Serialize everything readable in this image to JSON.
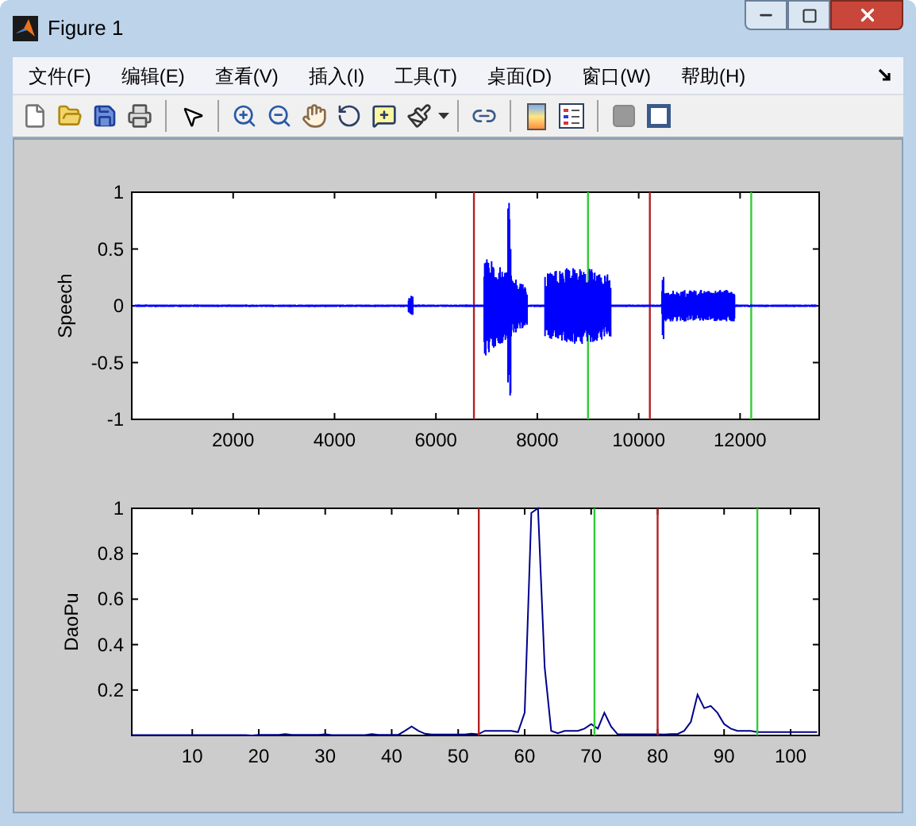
{
  "window": {
    "title": "Figure 1"
  },
  "menu": [
    {
      "label": "文件(F)"
    },
    {
      "label": "编辑(E)"
    },
    {
      "label": "查看(V)"
    },
    {
      "label": "插入(I)"
    },
    {
      "label": "工具(T)"
    },
    {
      "label": "桌面(D)"
    },
    {
      "label": "窗口(W)"
    },
    {
      "label": "帮助(H)"
    }
  ],
  "axes": [
    {
      "chart_data": {
        "type": "line",
        "ylabel": "Speech",
        "xlim": [
          0,
          13560
        ],
        "ylim": [
          -1,
          1
        ],
        "xticks": [
          2000,
          4000,
          6000,
          8000,
          10000,
          12000
        ],
        "yticks": [
          -1,
          -0.5,
          0,
          0.5,
          1
        ],
        "ref_lines": [
          {
            "axis": "x",
            "value": 6750,
            "color": "#b22222"
          },
          {
            "axis": "x",
            "value": 9000,
            "color": "#33cc33"
          },
          {
            "axis": "x",
            "value": 10220,
            "color": "#b22222"
          },
          {
            "axis": "x",
            "value": 12220,
            "color": "#33cc33"
          }
        ]
      }
    },
    {
      "chart_data": {
        "type": "line",
        "ylabel": "DaoPu",
        "xlim": [
          0.9,
          104.3
        ],
        "ylim": [
          0,
          1
        ],
        "xticks": [
          10,
          20,
          30,
          40,
          50,
          60,
          70,
          80,
          90,
          100
        ],
        "yticks": [
          0.2,
          0.4,
          0.6,
          0.8,
          1
        ],
        "x": [
          1,
          2,
          3,
          4,
          5,
          6,
          7,
          8,
          9,
          10,
          11,
          12,
          13,
          14,
          15,
          16,
          17,
          18,
          19,
          20,
          21,
          22,
          23,
          24,
          25,
          26,
          27,
          28,
          29,
          30,
          31,
          32,
          33,
          34,
          35,
          36,
          37,
          38,
          39,
          40,
          41,
          42,
          43,
          44,
          45,
          46,
          47,
          48,
          49,
          50,
          51,
          52,
          53,
          54,
          55,
          56,
          57,
          58,
          59,
          60,
          61,
          62,
          63,
          64,
          65,
          66,
          67,
          68,
          69,
          70,
          71,
          72,
          73,
          74,
          75,
          76,
          77,
          78,
          79,
          80,
          81,
          82,
          83,
          84,
          85,
          86,
          87,
          88,
          89,
          90,
          91,
          92,
          93,
          94,
          95,
          96,
          97,
          98,
          99,
          100,
          101,
          102,
          103,
          104
        ],
        "series": [
          {
            "color": "#00008b",
            "values": [
              0.002,
              0.002,
              0.002,
              0.002,
              0.002,
              0.002,
              0.002,
              0.002,
              0.002,
              0.002,
              0.002,
              0.002,
              0.002,
              0.002,
              0.002,
              0.002,
              0.002,
              0.002,
              0,
              0.003,
              0.003,
              0.003,
              0.003,
              0.006,
              0.003,
              0.003,
              0.003,
              0.003,
              0.003,
              0.005,
              0.002,
              0.002,
              0.002,
              0.002,
              0.002,
              0.002,
              0.006,
              0.003,
              0.003,
              0.003,
              0.003,
              0.02,
              0.04,
              0.02,
              0.008,
              0.004,
              0.004,
              0.004,
              0.004,
              0.004,
              0.004,
              0.008,
              0.005,
              0.02,
              0.02,
              0.02,
              0.02,
              0.02,
              0.015,
              0.1,
              0.98,
              1,
              0.3,
              0.02,
              0.01,
              0.02,
              0.02,
              0.02,
              0.03,
              0.05,
              0.03,
              0.1,
              0.04,
              0.005,
              0.005,
              0.005,
              0.005,
              0.005,
              0.005,
              0.005,
              0.004,
              0.006,
              0.006,
              0.02,
              0.06,
              0.18,
              0.12,
              0.13,
              0.1,
              0.05,
              0.03,
              0.02,
              0.02,
              0.02,
              0.015,
              0.015,
              0.015,
              0.015,
              0.015,
              0.015,
              0.015,
              0.015,
              0.015,
              0.015
            ]
          }
        ],
        "ref_lines": [
          {
            "axis": "x",
            "value": 53.1,
            "color": "#b22222"
          },
          {
            "axis": "x",
            "value": 70.5,
            "color": "#33cc33"
          },
          {
            "axis": "x",
            "value": 80,
            "color": "#b22222"
          },
          {
            "axis": "x",
            "value": 95,
            "color": "#33cc33"
          }
        ]
      }
    }
  ]
}
